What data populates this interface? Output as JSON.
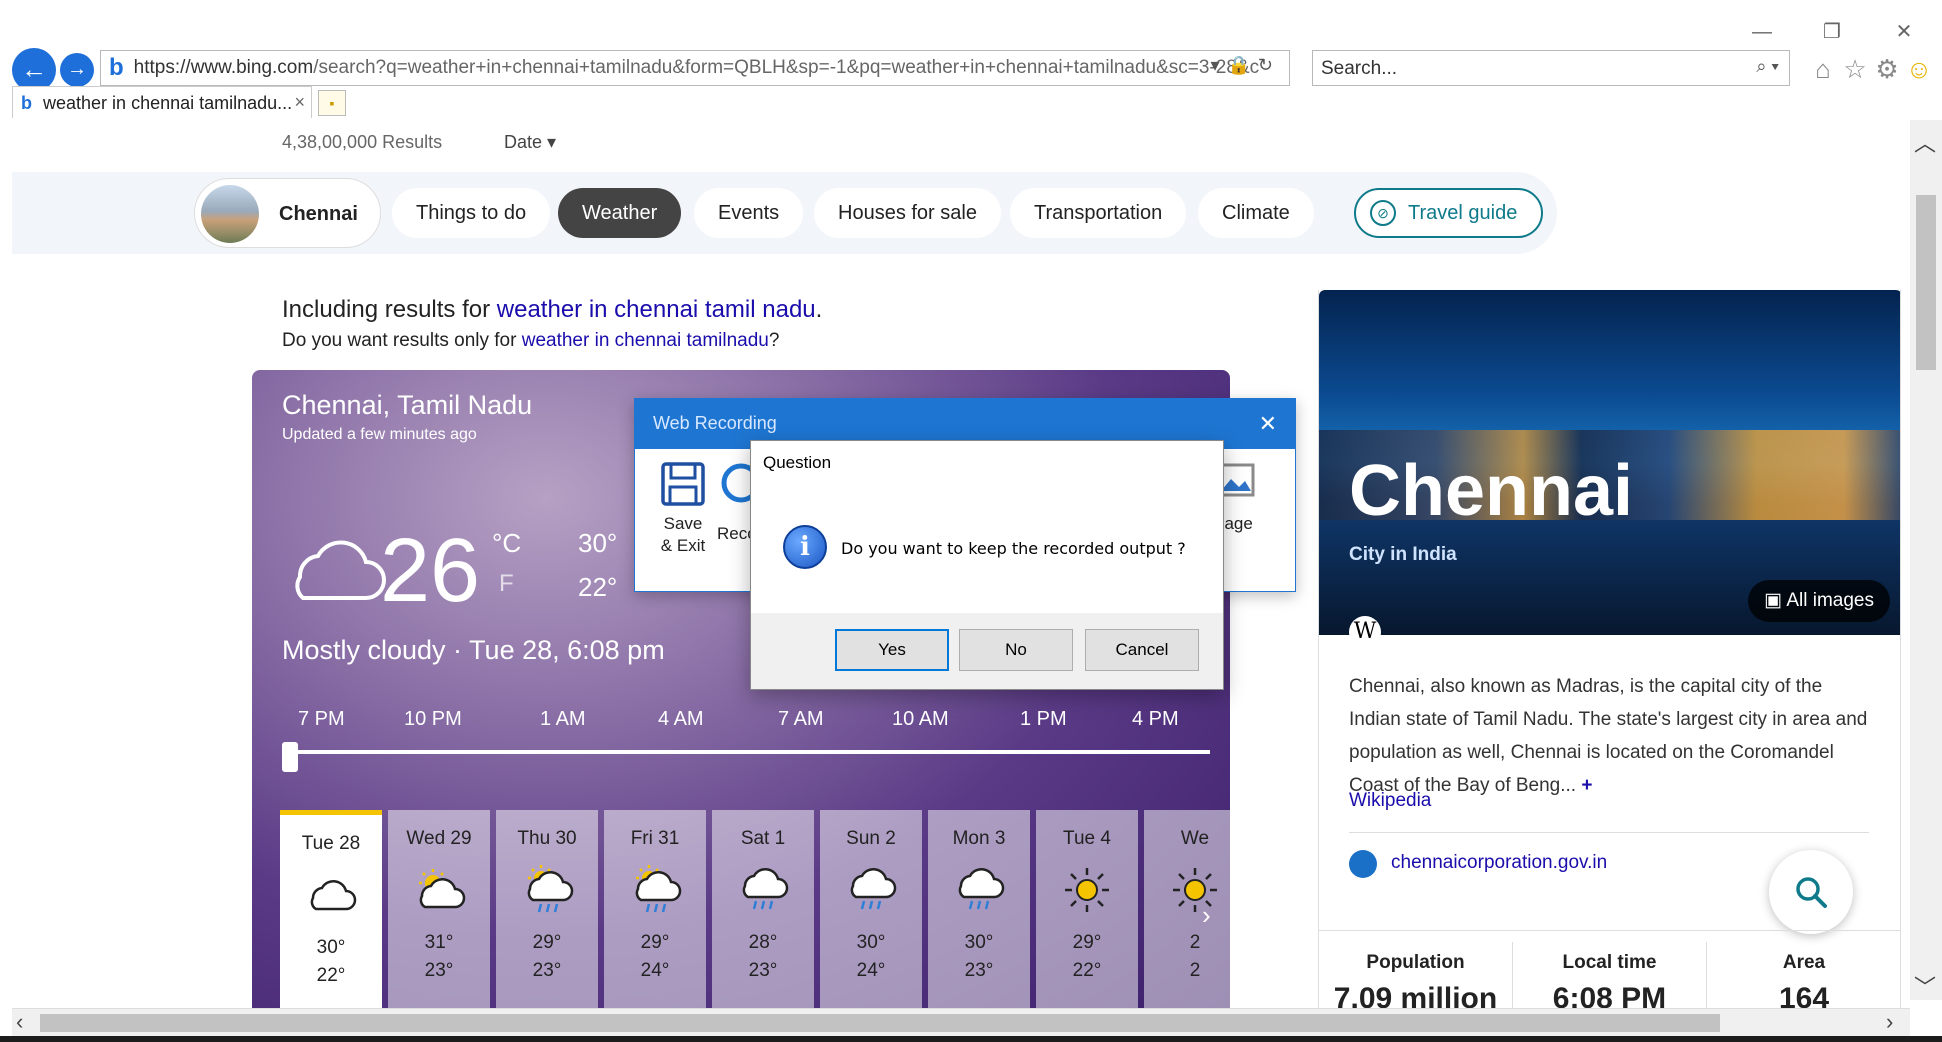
{
  "browser": {
    "address_url_main": "https://www.bing.com",
    "address_url_rest": "/search?q=weather+in+chennai+tamilnadu&form=QBLH&sp=-1&pq=weather+in+chennai+tamilnadu&sc=3-28&c",
    "search_placeholder": "Search...",
    "tab_title": "weather in chennai tamilnadu...",
    "tab_close": "×"
  },
  "results": {
    "count": "4,38,00,000 Results",
    "date_filter": "Date"
  },
  "chips": {
    "city": "Chennai",
    "things_to_do": "Things to do",
    "weather": "Weather",
    "events": "Events",
    "houses": "Houses for sale",
    "transportation": "Transportation",
    "climate": "Climate",
    "travel_guide": "Travel guide"
  },
  "spell": {
    "including_prefix": "Including results for ",
    "including_link": "weather in chennai tamil nadu",
    "including_suffix": ".",
    "only_prefix": "Do you want results only for ",
    "only_link": "weather in chennai tamilnadu",
    "only_suffix": "?"
  },
  "weather": {
    "location": "Chennai, Tamil Nadu",
    "updated": "Updated a few minutes ago",
    "temp": "26",
    "unit_c": "°C",
    "unit_f": "F",
    "hi": "30°",
    "lo": "22°",
    "condition": "Mostly cloudy · Tue 28, 6:08 pm",
    "hours": [
      "7 PM",
      "10 PM",
      "1 AM",
      "4 AM",
      "7 AM",
      "10 AM",
      "1 PM",
      "4 PM"
    ],
    "days": [
      {
        "name": "Tue 28",
        "icon": "cloudy-icon",
        "hi": "30°",
        "lo": "22°"
      },
      {
        "name": "Wed 29",
        "icon": "partly-sunny-icon",
        "hi": "31°",
        "lo": "23°"
      },
      {
        "name": "Thu 30",
        "icon": "sun-rain-icon",
        "hi": "29°",
        "lo": "23°"
      },
      {
        "name": "Fri 31",
        "icon": "sun-rain-icon",
        "hi": "29°",
        "lo": "24°"
      },
      {
        "name": "Sat 1",
        "icon": "rain-icon",
        "hi": "28°",
        "lo": "23°"
      },
      {
        "name": "Sun 2",
        "icon": "rain-icon",
        "hi": "30°",
        "lo": "24°"
      },
      {
        "name": "Mon 3",
        "icon": "rain-icon",
        "hi": "30°",
        "lo": "23°"
      },
      {
        "name": "Tue 4",
        "icon": "sunny-icon",
        "hi": "29°",
        "lo": "22°"
      },
      {
        "name": "We",
        "icon": "sunny-icon",
        "hi": "2",
        "lo": "2"
      }
    ]
  },
  "panel": {
    "name": "Chennai",
    "subtitle": "City in India",
    "all_images": "All images",
    "description": "Chennai, also known as Madras, is the capital city of the Indian state of Tamil Nadu. The state's largest city in area and population as well, Chennai is located on the Coromandel Coast of the Bay of Beng...",
    "more": "+",
    "wiki_link": "Wikipedia",
    "site": "chennaicorporation.gov.in",
    "facts": [
      {
        "label": "Population",
        "value": "7.09 million"
      },
      {
        "label": "Local time",
        "value": "6:08 PM"
      },
      {
        "label": "Area",
        "value": "164"
      }
    ]
  },
  "web_recording": {
    "title": "Web Recording",
    "save_label_1": "Save",
    "save_label_2": "& Exit",
    "record_label": "Reco",
    "image_label": "nage"
  },
  "dialog": {
    "title": "Question",
    "message": "Do you want to keep the recorded output ?",
    "yes": "Yes",
    "no": "No",
    "cancel": "Cancel"
  },
  "colors": {
    "accent": "#1e76d2",
    "link": "#1a0dab",
    "travel": "#0f7a8a"
  }
}
